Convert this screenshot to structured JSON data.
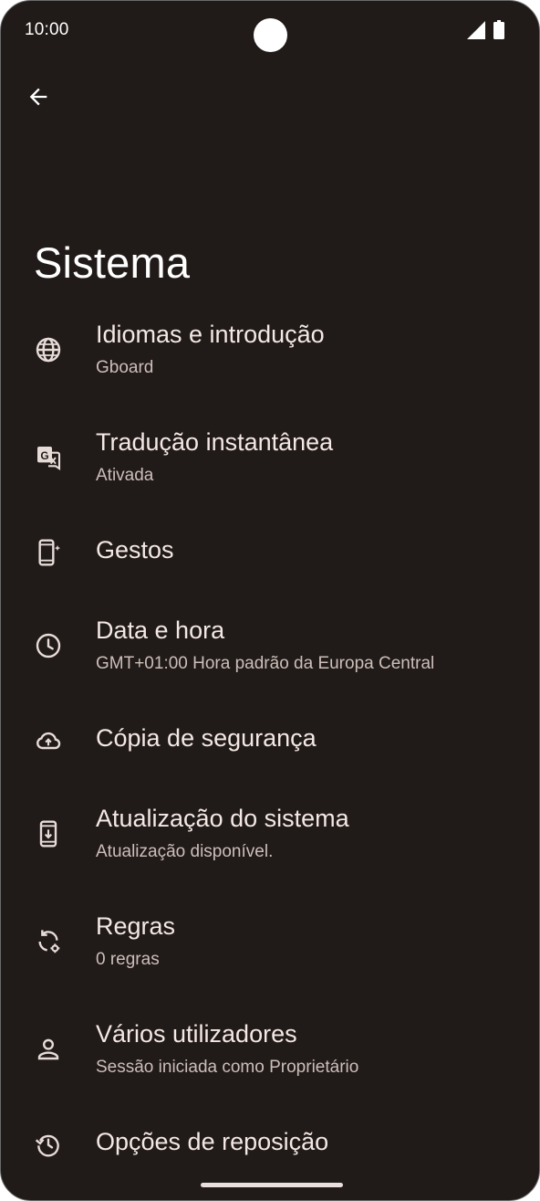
{
  "status_bar": {
    "time": "10:00"
  },
  "page": {
    "title": "Sistema"
  },
  "items": [
    {
      "title": "Idiomas e introdução",
      "subtitle": "Gboard",
      "icon": "globe-icon"
    },
    {
      "title": "Tradução instantânea",
      "subtitle": "Ativada",
      "icon": "translate-icon"
    },
    {
      "title": "Gestos",
      "icon": "gestures-phone-icon"
    },
    {
      "title": "Data e hora",
      "subtitle": "GMT+01:00 Hora padrão da Europa Central",
      "icon": "clock-icon"
    },
    {
      "title": "Cópia de segurança",
      "icon": "cloud-upload-icon"
    },
    {
      "title": "Atualização do sistema",
      "subtitle": "Atualização disponível.",
      "icon": "system-update-icon"
    },
    {
      "title": "Regras",
      "subtitle": "0 regras",
      "icon": "rules-icon"
    },
    {
      "title": "Vários utilizadores",
      "subtitle": "Sessão iniciada como Proprietário",
      "icon": "person-icon"
    },
    {
      "title": "Opções de reposição",
      "icon": "history-icon"
    }
  ]
}
